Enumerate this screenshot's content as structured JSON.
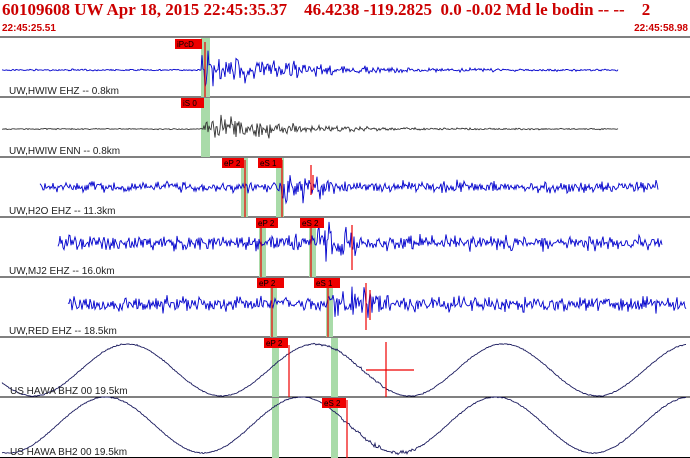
{
  "header": {
    "title": "60109608 UW Apr 18, 2015 22:45:35.37    46.4238 -119.2825  0.0 -0.02 Md le bodin -- --    2",
    "start_time": "22:45:25.51",
    "end_time": "22:45:58.98"
  },
  "colors": {
    "trace_blue": "#0000cc",
    "trace_dark": "#333333",
    "trace_navy": "#1a1a5e",
    "pick_red": "#ee0000",
    "band_green": "#a9dba9",
    "header_red": "#cc0000"
  },
  "channels": [
    {
      "label": "UW,HWIW EHZ -- 0.8km",
      "style": "noise_blue",
      "picks": [
        {
          "text": "iPcD"
        },
        {
          "text": ""
        }
      ]
    },
    {
      "label": "UW,HWIW ENN -- 0.8km",
      "style": "noise_dark",
      "picks": [
        {
          "text": "iS 0"
        }
      ]
    },
    {
      "label": "UW,H2O EHZ -- 11.3km",
      "style": "noise_blue",
      "picks": [
        {
          "text": "eP 2"
        },
        {
          "text": "eS 1"
        }
      ]
    },
    {
      "label": "UW,MJ2 EHZ -- 16.0km",
      "style": "noise_blue",
      "picks": [
        {
          "text": "eP 2"
        },
        {
          "text": "eS 2"
        }
      ]
    },
    {
      "label": "UW,RED EHZ -- 18.5km",
      "style": "noise_blue",
      "picks": [
        {
          "text": "eP 2"
        },
        {
          "text": "eS 1"
        }
      ]
    },
    {
      "label": "US HAWA BHZ 00 19.5km",
      "style": "wave_navy",
      "picks": [
        {
          "text": "eP 2"
        }
      ]
    },
    {
      "label": "US HAWA BH2 00 19.5km",
      "style": "wave_navy",
      "picks": [
        {
          "text": "eS 2"
        }
      ]
    }
  ]
}
